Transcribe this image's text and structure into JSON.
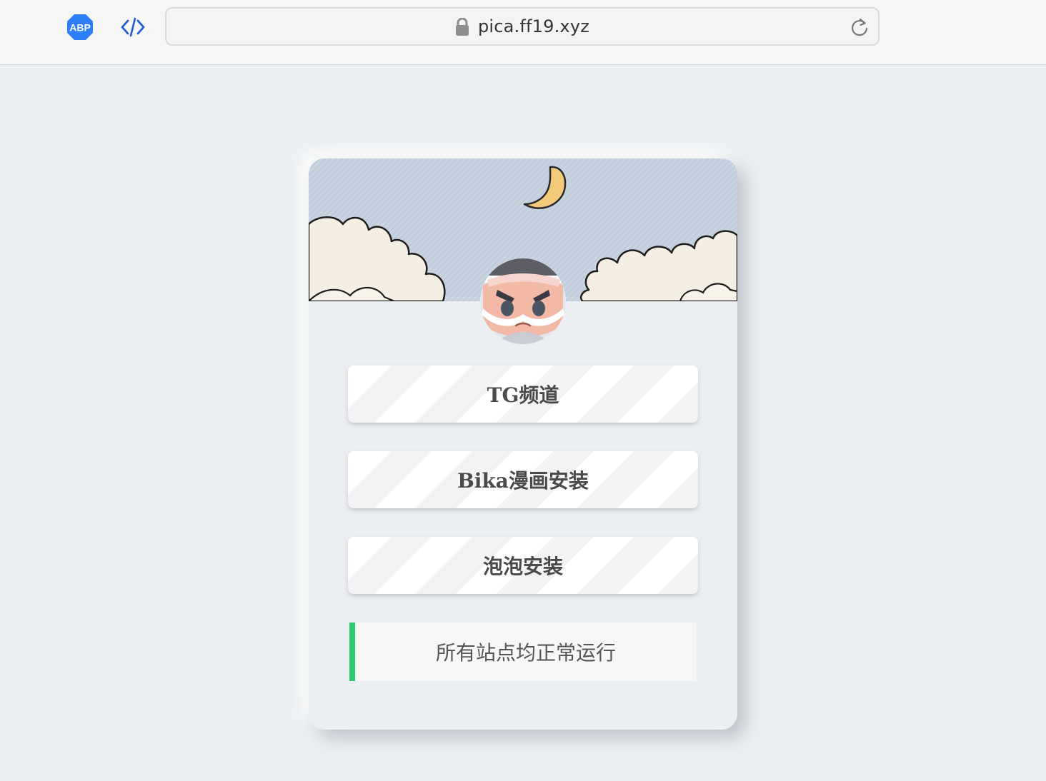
{
  "browser": {
    "url": "pica.ff19.xyz",
    "extensions": [
      {
        "name": "adblock-plus",
        "label": "ABP"
      },
      {
        "name": "developer-tools"
      }
    ]
  },
  "card": {
    "links": [
      {
        "label": "TG频道"
      },
      {
        "label": "Bika漫画安装"
      },
      {
        "label": "泡泡安装"
      }
    ],
    "status": {
      "text": "所有站点均正常运行",
      "color": "#2ecc71"
    }
  },
  "colors": {
    "page_bg": "#eceff2",
    "button_text": "#4a4a4a",
    "status_bar": "#2ecc71",
    "sky": "#c6d2df",
    "moon": "#f3c97a"
  }
}
